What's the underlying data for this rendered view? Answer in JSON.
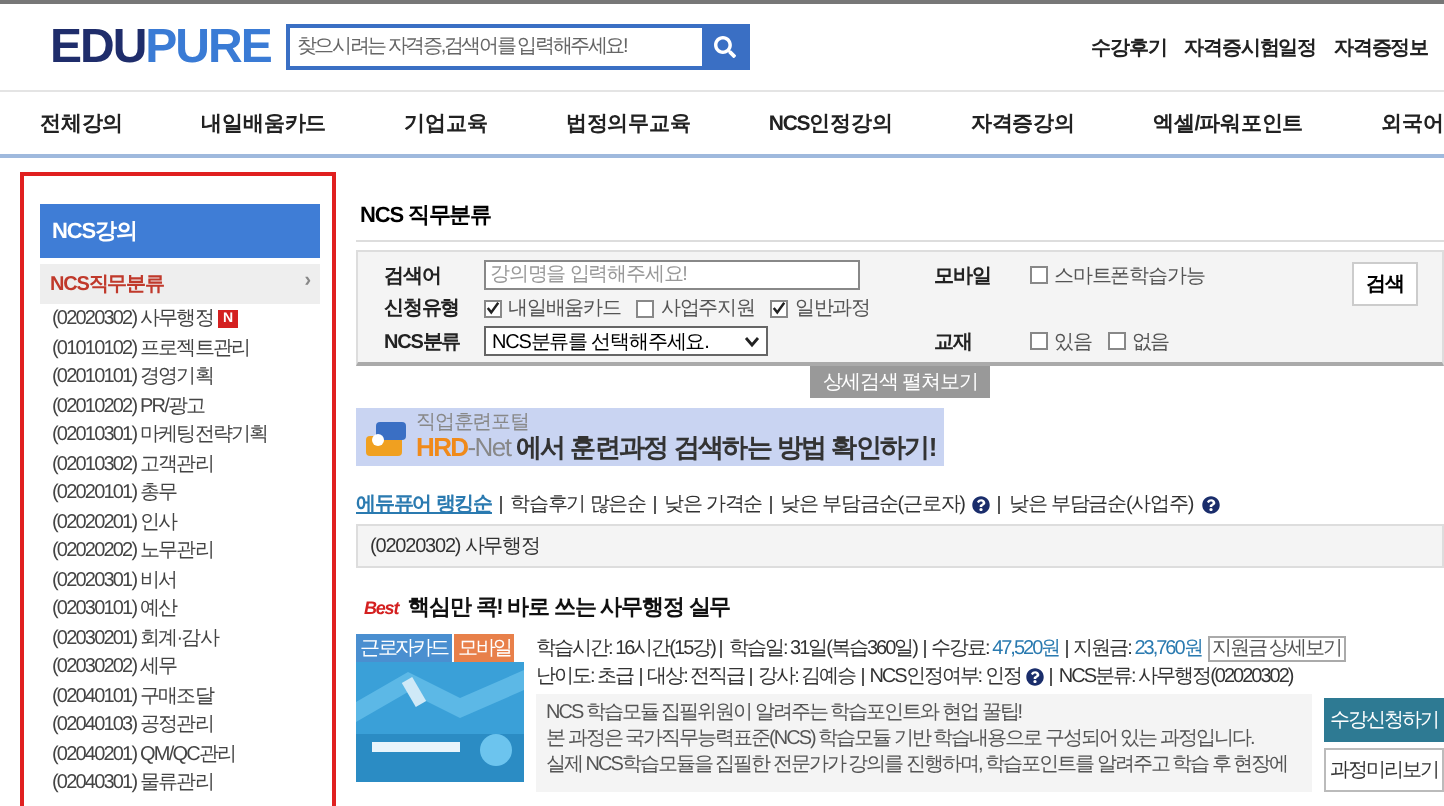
{
  "header": {
    "logo": {
      "first": "EDU",
      "second": "PURE"
    },
    "search": {
      "placeholder": "찾으시려는 자격증,검색어를 입력해주세요!"
    },
    "links": [
      "수강후기",
      "자격증시험일정",
      "자격증정보"
    ]
  },
  "nav": [
    "전체강의",
    "내일배움카드",
    "기업교육",
    "법정의무교육",
    "NCS인정강의",
    "자격증강의",
    "엑셀/파워포인트",
    "외국어"
  ],
  "sidebar": {
    "title": "NCS강의",
    "category": {
      "label": "NCS직무분류",
      "arrow": "›"
    },
    "items": [
      {
        "label": "(02020302) 사무행정",
        "badge": "N"
      },
      {
        "label": "(01010102) 프로젝트관리"
      },
      {
        "label": "(02010101) 경영기획"
      },
      {
        "label": "(02010202) PR/광고"
      },
      {
        "label": "(02010301) 마케팅전략기획"
      },
      {
        "label": "(02010302) 고객관리"
      },
      {
        "label": "(02020101) 총무"
      },
      {
        "label": "(02020201) 인사"
      },
      {
        "label": "(02020202) 노무관리"
      },
      {
        "label": "(02020301) 비서"
      },
      {
        "label": "(02030101) 예산"
      },
      {
        "label": "(02030201) 회계·감사"
      },
      {
        "label": "(02030202) 세무"
      },
      {
        "label": "(02040101) 구매조달"
      },
      {
        "label": "(02040103) 공정관리"
      },
      {
        "label": "(02040201) QM/QC관리"
      },
      {
        "label": "(02040301) 물류관리"
      }
    ]
  },
  "main": {
    "title": "NCS 직무분류",
    "search_panel": {
      "keyword": {
        "label": "검색어",
        "placeholder": "강의명을 입력해주세요!"
      },
      "apply_type": {
        "label": "신청유형",
        "options": [
          {
            "label": "내일배움카드",
            "checked": true
          },
          {
            "label": "사업주지원",
            "checked": false
          },
          {
            "label": "일반과정",
            "checked": true
          }
        ]
      },
      "ncs": {
        "label": "NCS분류",
        "value": "NCS분류를 선택해주세요."
      },
      "mobile": {
        "label": "모바일",
        "options": [
          {
            "label": "스마트폰학습가능",
            "checked": false
          }
        ]
      },
      "textbook": {
        "label": "교재",
        "options": [
          {
            "label": "있음",
            "checked": false
          },
          {
            "label": "없음",
            "checked": false
          }
        ]
      },
      "search_button": "검색",
      "expand": "상세검색 펼쳐보기"
    },
    "banner": {
      "small": "직업훈련포털",
      "brand_a": "HRD",
      "brand_b": "-Net",
      "text": "에서 훈련과정 검색하는 방법 확인하기!"
    },
    "sort": [
      {
        "label": "에듀퓨어 랭킹순",
        "selected": true,
        "help": false
      },
      {
        "label": "학습후기 많은순",
        "selected": false,
        "help": false
      },
      {
        "label": "낮은 가격순",
        "selected": false,
        "help": false
      },
      {
        "label": "낮은 부담금순(근로자)",
        "selected": false,
        "help": true
      },
      {
        "label": "낮은 부담금순(사업주)",
        "selected": false,
        "help": true
      }
    ],
    "category_box": "(02020302) 사무행정",
    "course": {
      "badge": "Best",
      "title": "핵심만 콕! 바로 쓰는 사무행정 실무",
      "tags": [
        {
          "label": "근로자카드",
          "color": "#4a8fd0"
        },
        {
          "label": "모바일",
          "color": "#e8804a"
        }
      ],
      "info_rows": [
        [
          {
            "label": "학습시간:",
            "value": "16시간(15강)",
            "accent": false
          },
          {
            "label": "학습일:",
            "value": "31일(복습360일)",
            "accent": false
          },
          {
            "label": "수강료:",
            "value": "47,520원",
            "accent": true
          },
          {
            "label": "지원금:",
            "value": "23,760원",
            "accent": true,
            "button": "지원금 상세보기"
          }
        ],
        [
          {
            "label": "난이도:",
            "value": "초급",
            "accent": false
          },
          {
            "label": "대상:",
            "value": "전직급",
            "accent": false
          },
          {
            "label": "강사:",
            "value": "김예승",
            "accent": false
          },
          {
            "label": "NCS인정여부:",
            "value": "인정",
            "accent": false,
            "help": true
          },
          {
            "label": "NCS분류:",
            "value": "사무행정(02020302)",
            "accent": false
          }
        ]
      ],
      "description": [
        "NCS 학습모듈 집필위원이 알려주는 학습포인트와 현업 꿀팁!",
        "본 과정은 국가직무능력표준(NCS) 학습모듈 기반 학습내용으로 구성되어 있는 과정입니다.",
        "실제 NCS학습모듈을 집필한 전문가가 강의를 진행하며, 학습포인트를 알려주고 학습 후 현장에"
      ],
      "buttons": [
        {
          "label": "수강신청하기",
          "kind": "primary"
        },
        {
          "label": "과정미리보기",
          "kind": "secondary"
        }
      ]
    }
  }
}
